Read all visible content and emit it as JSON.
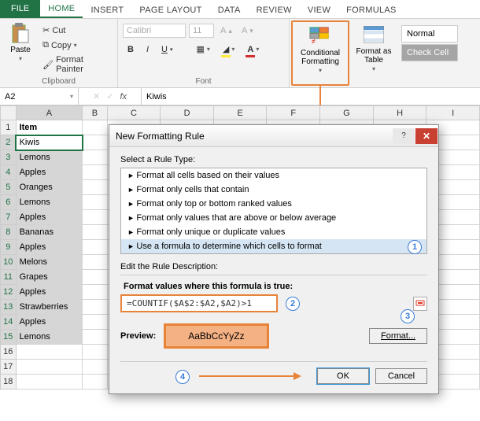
{
  "tabs": {
    "file": "FILE",
    "home": "HOME",
    "insert": "INSERT",
    "pagelayout": "PAGE LAYOUT",
    "data": "DATA",
    "review": "REVIEW",
    "view": "VIEW",
    "formulas": "FORMULAS"
  },
  "ribbon": {
    "clipboard": {
      "paste": "Paste",
      "cut": "Cut",
      "copy": "Copy",
      "painter": "Format Painter",
      "group": "Clipboard"
    },
    "font": {
      "group": "Font",
      "name": "Calibri",
      "size": "11"
    },
    "cf": "Conditional Formatting",
    "fat": "Format as Table",
    "styles": {
      "normal": "Normal",
      "check": "Check Cell"
    }
  },
  "namebox": "A2",
  "formula": "Kiwis",
  "columns": [
    "A",
    "B",
    "C",
    "D",
    "E",
    "F",
    "G",
    "H",
    "I"
  ],
  "header_row": "Item",
  "rows": [
    "Kiwis",
    "Lemons",
    "Apples",
    "Oranges",
    "Lemons",
    "Apples",
    "Bananas",
    "Apples",
    "Melons",
    "Grapes",
    "Apples",
    "Strawberries",
    "Apples",
    "Lemons"
  ],
  "dialog": {
    "title": "New Formatting Rule",
    "select_label": "Select a Rule Type:",
    "types": [
      "Format all cells based on their values",
      "Format only cells that contain",
      "Format only top or bottom ranked values",
      "Format only values that are above or below average",
      "Format only unique or duplicate values",
      "Use a formula to determine which cells to format"
    ],
    "edit_label": "Edit the Rule Description:",
    "formula_label": "Format values where this formula is true:",
    "formula_value": "=COUNTIF($A$2:$A2,$A2)>1",
    "preview_label": "Preview:",
    "preview_text": "AaBbCcYyZz",
    "format_btn": "Format...",
    "ok": "OK",
    "cancel": "Cancel"
  },
  "callouts": {
    "c1": "1",
    "c2": "2",
    "c3": "3",
    "c4": "4"
  }
}
